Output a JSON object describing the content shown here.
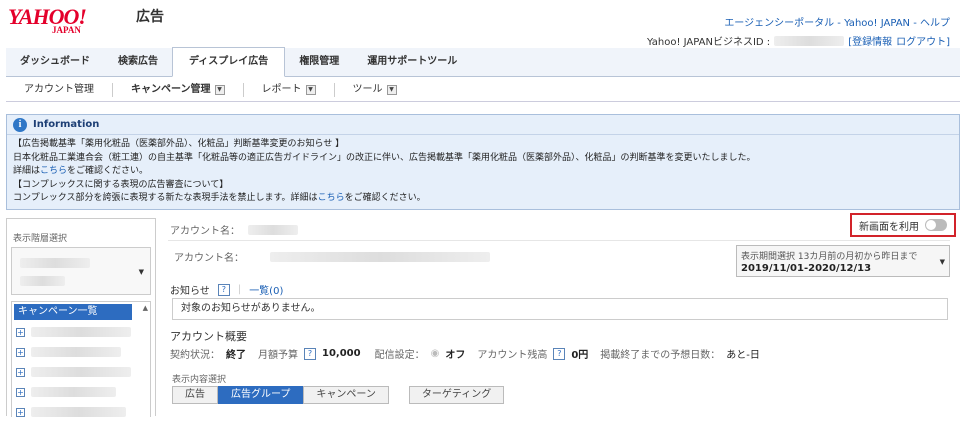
{
  "header": {
    "logo_text": "YAHOO!",
    "logo_sub": "JAPAN",
    "service_title": "広告",
    "top_links": "エージェンシーポータル - Yahoo! JAPAN - ヘルプ",
    "biz_id_label": "Yahoo! JAPANビジネスID :",
    "account_info_link": "[登録情報",
    "logout_link": "ログアウト]"
  },
  "tabs": [
    {
      "label": "ダッシュボード"
    },
    {
      "label": "検索広告"
    },
    {
      "label": "ディスプレイ広告",
      "active": true
    },
    {
      "label": "権限管理"
    },
    {
      "label": "運用サポートツール"
    }
  ],
  "subnav": [
    {
      "label": "アカウント管理"
    },
    {
      "label": "キャンペーン管理"
    },
    {
      "label": "レポート"
    },
    {
      "label": "ツール"
    }
  ],
  "info": {
    "title": "Information",
    "line1": "【広告掲載基準「薬用化粧品（医薬部外品）、化粧品」判断基準変更のお知らせ 】",
    "line2": "日本化粧品工業連合会（粧工連）の自主基準「化粧品等の適正広告ガイドライン」の改正に伴い、広告掲載基準「薬用化粧品（医薬部外品）、化粧品」の判断基準を変更いたしました。",
    "line3_pre": "詳細は",
    "line3_link": "こちら",
    "line3_post": "をご確認ください。",
    "line4": "【コンプレックスに関する表現の広告審査について】",
    "line5_pre": "コンプレックス部分を誇張に表現する新たな表現手法を禁止します。詳細は",
    "line5_link": "こちら",
    "line5_post": "をご確認ください。"
  },
  "left": {
    "level_label": "表示階層選択",
    "campaign_list_title": "キャンペーン一覧"
  },
  "main": {
    "account_name_label_top": "アカウント名：",
    "new_screen_label": "新画面を利用",
    "account_name_label": "アカウント名：",
    "period_label": "表示期間選択",
    "period_value": "13カ月前の月初から昨日まで",
    "period_range": "2019/11/01-2020/12/13",
    "notice_label": "お知らせ",
    "notice_link": "一覧(0)",
    "notice_text": "対象のお知らせがありません。",
    "overview_title": "アカウント概要",
    "contract_label": "契約状況：",
    "contract_value": "終了",
    "budget_label": "月額予算",
    "budget_value": "10,000",
    "delivery_label": "配信設定：",
    "delivery_value": "オフ",
    "balance_label": "アカウント残高",
    "balance_value": "0円",
    "days_label": "掲載終了までの予想日数：",
    "days_value": "あと-日",
    "content_select_label": "表示内容選択",
    "view_buttons": [
      {
        "label": "広告"
      },
      {
        "label": "広告グループ",
        "active": true
      },
      {
        "label": "キャンペーン"
      },
      {
        "label": "ターゲティング"
      }
    ]
  }
}
